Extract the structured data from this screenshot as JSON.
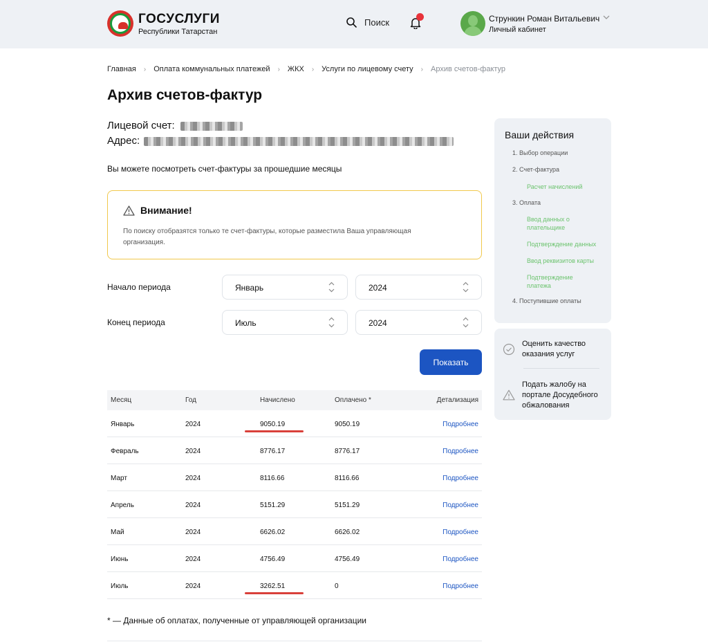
{
  "header": {
    "brand_title": "ГОСУСЛУГИ",
    "brand_subtitle": "Республики Татарстан",
    "search_label": "Поиск",
    "user_name": "Стрункин Роман Витальевич",
    "user_subtitle": "Личный кабинет",
    "notification_color": "#e8333a"
  },
  "breadcrumbs": [
    "Главная",
    "Оплата коммунальных платежей",
    "ЖКХ",
    "Услуги по лицевому счету",
    "Архив счетов-фактур"
  ],
  "page": {
    "title": "Архив счетов-фактур",
    "account_label": "Лицевой счет:",
    "address_label": "Адрес:",
    "intro": "Вы можете посмотреть счет-фактуры за прошедшие месяцы"
  },
  "alert": {
    "title": "Внимание!",
    "text": "По поиску отобразятся только те счет-фактуры, которые разместила Ваша управляющая организация."
  },
  "period": {
    "start_label": "Начало периода",
    "start_month": "Январь",
    "start_year": "2024",
    "end_label": "Конец периода",
    "end_month": "Июль",
    "end_year": "2024"
  },
  "show_button": "Показать",
  "table": {
    "headers": [
      "Месяц",
      "Год",
      "Начислено",
      "Оплачено *",
      "Детализация"
    ],
    "rows": [
      [
        "Январь",
        "2024",
        "9050.19",
        "9050.19",
        "Подробнее"
      ],
      [
        "Февраль",
        "2024",
        "8776.17",
        "8776.17",
        "Подробнее"
      ],
      [
        "Март",
        "2024",
        "8116.66",
        "8116.66",
        "Подробнее"
      ],
      [
        "Апрель",
        "2024",
        "5151.29",
        "5151.29",
        "Подробнее"
      ],
      [
        "Май",
        "2024",
        "6626.02",
        "6626.02",
        "Подробнее"
      ],
      [
        "Июнь",
        "2024",
        "4756.49",
        "4756.49",
        "Подробнее"
      ],
      [
        "Июль",
        "2024",
        "3262.51",
        "0",
        "Подробнее"
      ]
    ]
  },
  "footnote": "* — Данные об оплатах, полученные от управляющей организации",
  "sidebar": {
    "title": "Ваши действия",
    "steps": [
      "1. Выбор операции",
      "2. Счет-фактура",
      "Расчет начислений",
      "3. Оплата",
      "Ввод данных о плательщике",
      "Подтверждение данных",
      "Ввод реквизитов карты",
      "Подтверждение платежа",
      "4. Поступившие оплаты"
    ],
    "actions": [
      "Оценить качество оказания услуг",
      "Подать жалобу на портале Досудебного обжалования"
    ]
  },
  "colors": {
    "accent": "#1c55c2",
    "sub_step": "#6cc36e",
    "alert_border": "#f1c84b",
    "highlight_underline": "#d9403a"
  }
}
